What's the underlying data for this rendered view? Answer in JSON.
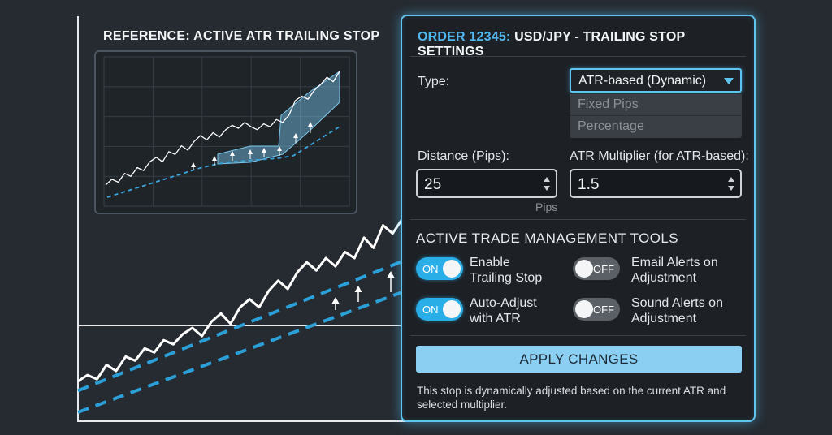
{
  "reference": {
    "title": "REFERENCE: ACTIVE ATR TRAILING STOP"
  },
  "settings": {
    "order_label": "ORDER 12345:",
    "title_rest": " USD/JPY - TRAILING STOP SETTINGS",
    "type_label": "Type:",
    "type_selected": "ATR-based (Dynamic)",
    "type_options": [
      "Fixed Pips",
      "Percentage"
    ],
    "distance_label": "Distance (Pips):",
    "distance_value": "25",
    "distance_unit": "Pips",
    "atr_label": "ATR Multiplier (for ATR-based):",
    "atr_value": "1.5",
    "tools_title": "ACTIVE TRADE MANAGEMENT TOOLS",
    "tools": [
      {
        "state": "ON",
        "line1": "Enable",
        "line2": "Trailing Stop"
      },
      {
        "state": "OFF",
        "line1": "Email Alerts on",
        "line2": "Adjustment"
      },
      {
        "state": "ON",
        "line1": "Auto-Adjust",
        "line2": "with ATR"
      },
      {
        "state": "OFF",
        "line1": "Sound Alerts on",
        "line2": "Adjustment"
      }
    ],
    "apply_label": "APPLY CHANGES",
    "note": "This stop is dynamically adjusted based on the current ATR and selected multiplier."
  },
  "colors": {
    "accent": "#5ec4f0",
    "toggle_on": "#29aee8",
    "toggle_off": "#5b6066",
    "price_line": "#ffffff",
    "stop_line": "#2a9fd8",
    "background": "#262b31"
  },
  "icons": [
    "chevron-down-icon",
    "spinner-up-icon",
    "spinner-down-icon",
    "stop-adjust-arrow-icon"
  ],
  "chart_data": [
    {
      "type": "line",
      "title": "",
      "series": [
        {
          "values": [
            1.0,
            1.3,
            1.1,
            1.8,
            1.5,
            2.2,
            2.0,
            2.6,
            2.4,
            3.0,
            2.8,
            3.3,
            3.6,
            3.2,
            3.9,
            4.3,
            3.8,
            4.6,
            5.0,
            4.6,
            5.4,
            5.9,
            5.5,
            6.3,
            6.8,
            6.4,
            7.0,
            6.6,
            7.3,
            7.0,
            8.0,
            7.5,
            8.6,
            8.2,
            8.9
          ]
        },
        {
          "values": [
            0.2,
            0.5,
            0.8,
            1.1,
            1.4,
            1.7,
            2.0,
            2.3,
            2.6,
            2.9,
            3.2,
            3.5,
            3.8,
            4.1,
            4.4,
            4.7,
            5.0
          ]
        },
        {
          "values": [
            0.0,
            0.3,
            0.6,
            0.9,
            1.2,
            1.5,
            1.8,
            2.1,
            2.4,
            2.7,
            3.0,
            3.3,
            3.6,
            3.9,
            4.2,
            4.5,
            4.8
          ]
        }
      ]
    },
    {
      "type": "line",
      "title": "",
      "series": [
        {
          "values": [
            1.0,
            1.4,
            1.2,
            1.8,
            1.6,
            2.2,
            2.0,
            2.6,
            2.9,
            2.6,
            3.3,
            3.1,
            3.7,
            3.4,
            4.0,
            4.4,
            4.1,
            4.6,
            4.3,
            4.8,
            5.1,
            4.9,
            5.3,
            5.0,
            4.8,
            5.2,
            5.0,
            5.5,
            5.3,
            5.8,
            6.8,
            7.1,
            6.9,
            7.5,
            7.9,
            8.4,
            8.1,
            8.8
          ]
        },
        {
          "values": [
            0.6,
            1.0,
            1.4,
            1.8,
            2.2,
            2.6,
            3.0,
            3.3,
            3.5,
            3.6,
            3.7,
            3.8,
            4.0,
            4.8,
            5.6,
            6.4
          ]
        }
      ]
    }
  ]
}
